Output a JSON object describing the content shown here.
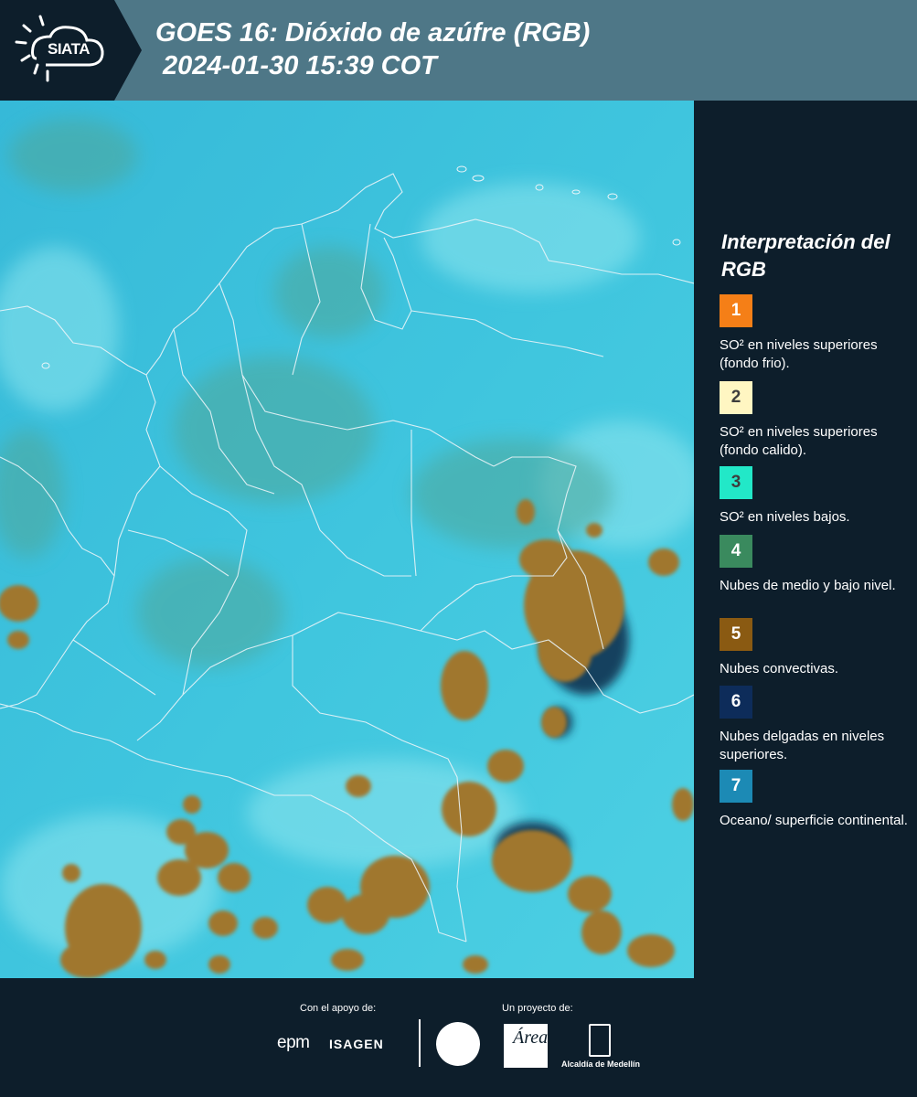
{
  "header": {
    "logo_text": "SIATA",
    "title_line1": "GOES 16: Dióxido de azúfre (RGB)",
    "title_line2": "2024-01-30 15:39 COT"
  },
  "legend": {
    "title": "Interpretación del RGB",
    "items": [
      {
        "number": "1",
        "label": "SO² en niveles superiores (fondo frio).",
        "color": "#f57f17"
      },
      {
        "number": "2",
        "label": "SO² en niveles superiores (fondo calido).",
        "color": "#fff6c2"
      },
      {
        "number": "3",
        "label": "SO² en niveles bajos.",
        "color": "#22e8c8"
      },
      {
        "number": "4",
        "label": "Nubes de medio y bajo nivel.",
        "color": "#3a8a5e"
      },
      {
        "number": "5",
        "label": "Nubes convectivas.",
        "color": "#8a5a12"
      },
      {
        "number": "6",
        "label": "Nubes delgadas en niveles superiores.",
        "color": "#0d2c5a"
      },
      {
        "number": "7",
        "label": "Oceano/ superficie continental.",
        "color": "#1c8ab5"
      }
    ]
  },
  "footer": {
    "support_label": "Con el apoyo de:",
    "project_label": "Un proyecto de:",
    "epm": "epm",
    "isagen": "ISAGEN",
    "area_logo": "Área",
    "alcaldia": "Alcaldía de Medellín"
  },
  "colors": {
    "header_bg": "#4e7787",
    "panel_bg": "#0d1e2b",
    "map_cyan": "#3ec3dc"
  }
}
